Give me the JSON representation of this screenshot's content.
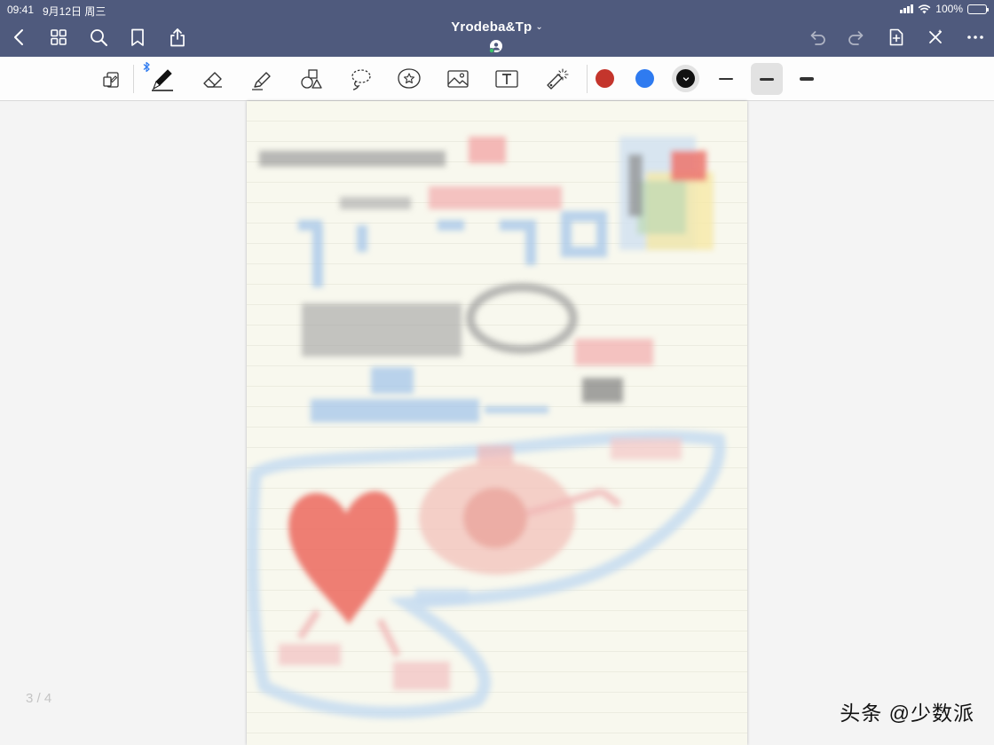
{
  "status_bar": {
    "time": "09:41",
    "date": "9月12日 周三",
    "battery": "100%",
    "battery_level": 1.0
  },
  "header": {
    "title": "Yrodeba&Tp",
    "icons": {
      "back": "chevron-left-icon",
      "grid": "thumbnails-grid-icon",
      "search": "search-icon",
      "bookmark": "bookmark-icon",
      "share": "share-icon",
      "undo": "undo-icon",
      "redo": "redo-icon",
      "add_page": "add-page-icon",
      "close": "close-icon",
      "more": "more-icon"
    }
  },
  "toolbar": {
    "tools": [
      "read-only-toggle",
      "pen",
      "eraser",
      "highlighter",
      "shapes",
      "lasso",
      "elements",
      "image",
      "text",
      "laser-pointer"
    ],
    "selected_tool": "pen",
    "colors": [
      "#c4352c",
      "#2f7bf0",
      "#111111"
    ],
    "selected_color": "#111111",
    "stroke_widths": [
      "thin",
      "medium",
      "thick"
    ],
    "selected_stroke": "medium"
  },
  "page": {
    "indicator": "3 / 4",
    "paper_color": "#f8f8ee"
  },
  "watermark": {
    "text": "头条 @少数派"
  }
}
